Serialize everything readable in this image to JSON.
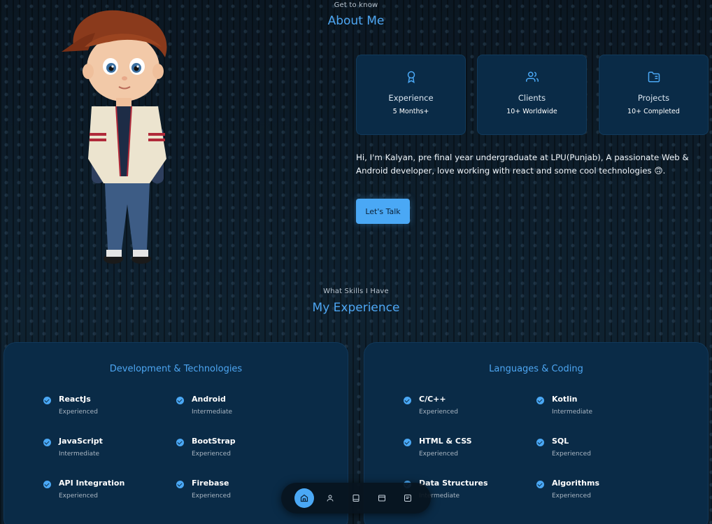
{
  "about": {
    "kicker": "Get to know",
    "title": "About Me",
    "cards": [
      {
        "icon": "award-icon",
        "label": "Experience",
        "value": "5 Months+"
      },
      {
        "icon": "users-icon",
        "label": "Clients",
        "value": "10+ Worldwide"
      },
      {
        "icon": "folder-icon",
        "label": "Projects",
        "value": "10+ Completed"
      }
    ],
    "bio": "Hi, I'm Kalyan, pre final year undergraduate at LPU(Punjab), A passionate Web & Android developer, love working with react and some cool technologies 🙃.",
    "cta_label": "Let's Talk"
  },
  "experience": {
    "kicker": "What Skills I Have",
    "title": "My Experience",
    "panels": [
      {
        "title": "Development & Technologies",
        "skills": [
          {
            "name": "ReactJs",
            "level": "Experienced"
          },
          {
            "name": "Android",
            "level": "Intermediate"
          },
          {
            "name": "JavaScript",
            "level": "Intermediate"
          },
          {
            "name": "BootStrap",
            "level": "Experienced"
          },
          {
            "name": "API Integration",
            "level": "Experienced"
          },
          {
            "name": "Firebase",
            "level": "Experienced"
          }
        ]
      },
      {
        "title": "Languages & Coding",
        "skills": [
          {
            "name": "C/C++",
            "level": "Experienced"
          },
          {
            "name": "Kotlin",
            "level": "Intermediate"
          },
          {
            "name": "HTML & CSS",
            "level": "Experienced"
          },
          {
            "name": "SQL",
            "level": "Experienced"
          },
          {
            "name": "Data Structures",
            "level": "Intermediate"
          },
          {
            "name": "Algorithms",
            "level": "Experienced"
          }
        ]
      }
    ]
  },
  "nav": {
    "items": [
      "home-icon",
      "user-icon",
      "book-icon",
      "briefcase-icon",
      "message-icon"
    ],
    "active": "home-icon"
  },
  "colors": {
    "accent": "#4aa8f5",
    "card_bg": "#0a2b47",
    "page_bg": "#0c1a26"
  }
}
